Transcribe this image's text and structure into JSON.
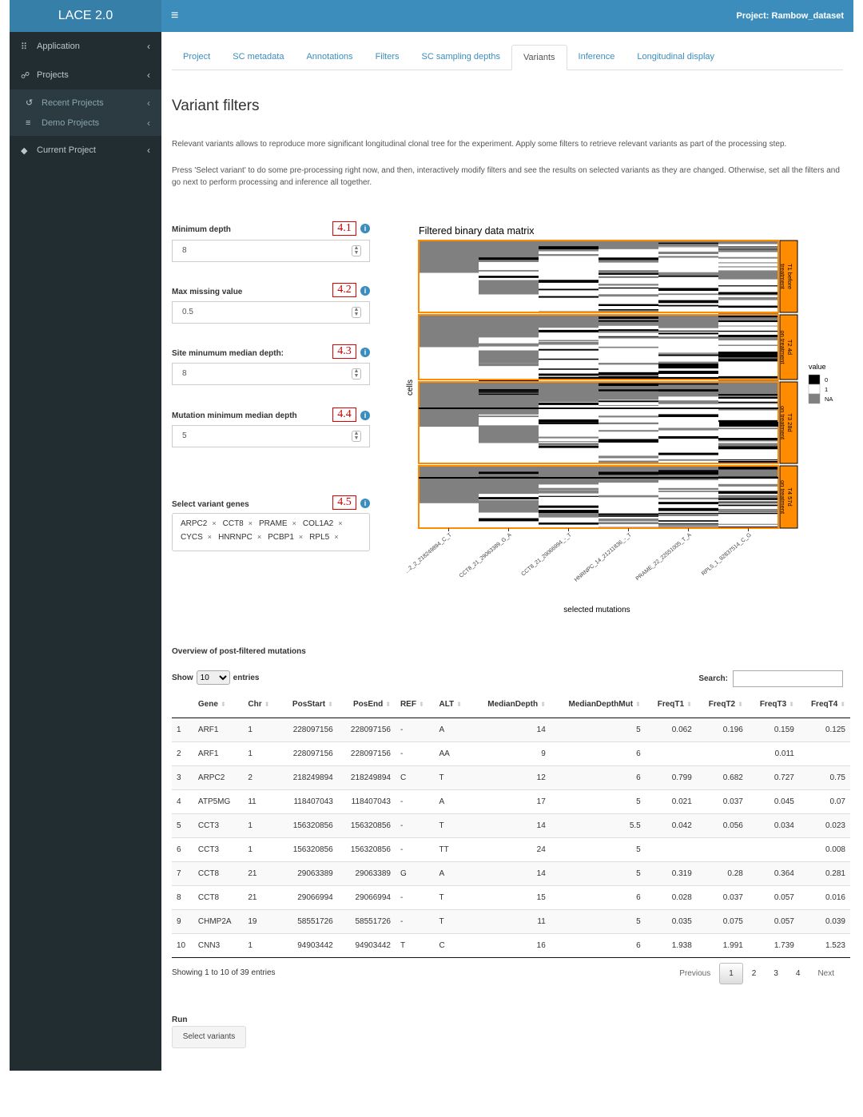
{
  "app": {
    "logo": "LACE 2.0",
    "project_title": "Project: Rambow_dataset"
  },
  "sidebar": {
    "items": [
      {
        "label": "Application",
        "icon": "grid-icon"
      },
      {
        "label": "Projects",
        "icon": "users-icon"
      },
      {
        "label": "Recent Projects",
        "icon": "history-icon"
      },
      {
        "label": "Demo Projects",
        "icon": "database-icon"
      },
      {
        "label": "Current Project",
        "icon": "cube-icon"
      }
    ]
  },
  "tabs": [
    "Project",
    "SC metadata",
    "Annotations",
    "Filters",
    "SC sampling depths",
    "Variants",
    "Inference",
    "Longitudinal display"
  ],
  "active_tab": "Variants",
  "page": {
    "title": "Variant filters",
    "para1": "Relevant variants allows to reproduce more significant longitudinal clonal tree for the experiment. Apply some filters to retrieve relevant variants as part of the processing step.",
    "para2": "Press 'Select variant' to do some pre-processing right now, and then, interactively modify filters and see the results on selected variants as they are changed. Otherwise, set all the filters and go next to perform processing and inference all together."
  },
  "filters": {
    "min_depth": {
      "label": "Minimum depth",
      "value": "8",
      "badge": "4.1"
    },
    "max_missing": {
      "label": "Max missing value",
      "value": "0.5",
      "badge": "4.2"
    },
    "site_median": {
      "label": "Site minumum median depth:",
      "value": "8",
      "badge": "4.3"
    },
    "mut_median": {
      "label": "Mutation minimum median depth",
      "value": "5",
      "badge": "4.4"
    },
    "genes": {
      "label": "Select variant genes",
      "badge": "4.5",
      "selected": [
        "ARPC2",
        "CCT8",
        "PRAME",
        "COL1A2",
        "CYCS",
        "HNRNPC",
        "PCBP1",
        "RPL5"
      ]
    }
  },
  "chart_data": {
    "type": "heatmap",
    "title": "Filtered binary data matrix",
    "xlabel": "selected mutations",
    "ylabel": "cells",
    "x_tick_labels": [
      "...2_2_218249894_C_T",
      "CCT8_21_29063389_G_A",
      "CCT8_21_29066994_-_T",
      "HNRNPC_14_21211836_-_T",
      "PRAME_22_22551005_T_A",
      "RPL5_1_92837514_C_G"
    ],
    "row_groups": [
      "T1 before treatment",
      "T2 4d on treatment",
      "T3 28d on treatment",
      "T4 57d on treatment"
    ],
    "legend": {
      "title": "value",
      "entries": [
        {
          "label": "0",
          "color": "#000000"
        },
        {
          "label": "1",
          "color": "#ffffff"
        },
        {
          "label": "NA",
          "color": "#808080"
        }
      ]
    },
    "colors": {
      "group_border": "#ff8c00",
      "na": "#808080"
    }
  },
  "table": {
    "overview_label": "Overview of post-filtered mutations",
    "show_label": "Show",
    "entries_label": "entries",
    "page_size": "10",
    "search_label": "Search:",
    "columns": [
      "",
      "Gene",
      "Chr",
      "PosStart",
      "PosEnd",
      "REF",
      "ALT",
      "MedianDepth",
      "MedianDepthMut",
      "FreqT1",
      "FreqT2",
      "FreqT3",
      "FreqT4"
    ],
    "rows": [
      [
        "1",
        "ARF1",
        "1",
        "228097156",
        "228097156",
        "-",
        "A",
        "14",
        "5",
        "0.062",
        "0.196",
        "0.159",
        "0.125"
      ],
      [
        "2",
        "ARF1",
        "1",
        "228097156",
        "228097156",
        "-",
        "AA",
        "9",
        "6",
        "",
        "",
        "0.011",
        ""
      ],
      [
        "3",
        "ARPC2",
        "2",
        "218249894",
        "218249894",
        "C",
        "T",
        "12",
        "6",
        "0.799",
        "0.682",
        "0.727",
        "0.75"
      ],
      [
        "4",
        "ATP5MG",
        "11",
        "118407043",
        "118407043",
        "-",
        "A",
        "17",
        "5",
        "0.021",
        "0.037",
        "0.045",
        "0.07"
      ],
      [
        "5",
        "CCT3",
        "1",
        "156320856",
        "156320856",
        "-",
        "T",
        "14",
        "5.5",
        "0.042",
        "0.056",
        "0.034",
        "0.023"
      ],
      [
        "6",
        "CCT3",
        "1",
        "156320856",
        "156320856",
        "-",
        "TT",
        "24",
        "5",
        "",
        "",
        "",
        "0.008"
      ],
      [
        "7",
        "CCT8",
        "21",
        "29063389",
        "29063389",
        "G",
        "A",
        "14",
        "5",
        "0.319",
        "0.28",
        "0.364",
        "0.281"
      ],
      [
        "8",
        "CCT8",
        "21",
        "29066994",
        "29066994",
        "-",
        "T",
        "15",
        "6",
        "0.028",
        "0.037",
        "0.057",
        "0.016"
      ],
      [
        "9",
        "CHMP2A",
        "19",
        "58551726",
        "58551726",
        "-",
        "T",
        "11",
        "5",
        "0.035",
        "0.075",
        "0.057",
        "0.039"
      ],
      [
        "10",
        "CNN3",
        "1",
        "94903442",
        "94903442",
        "T",
        "C",
        "16",
        "6",
        "1.938",
        "1.991",
        "1.739",
        "1.523"
      ]
    ],
    "info": "Showing 1 to 10 of 39 entries",
    "pager": {
      "previous": "Previous",
      "pages": [
        "1",
        "2",
        "3",
        "4"
      ],
      "next": "Next"
    }
  },
  "run": {
    "label": "Run",
    "button": "Select variants"
  }
}
